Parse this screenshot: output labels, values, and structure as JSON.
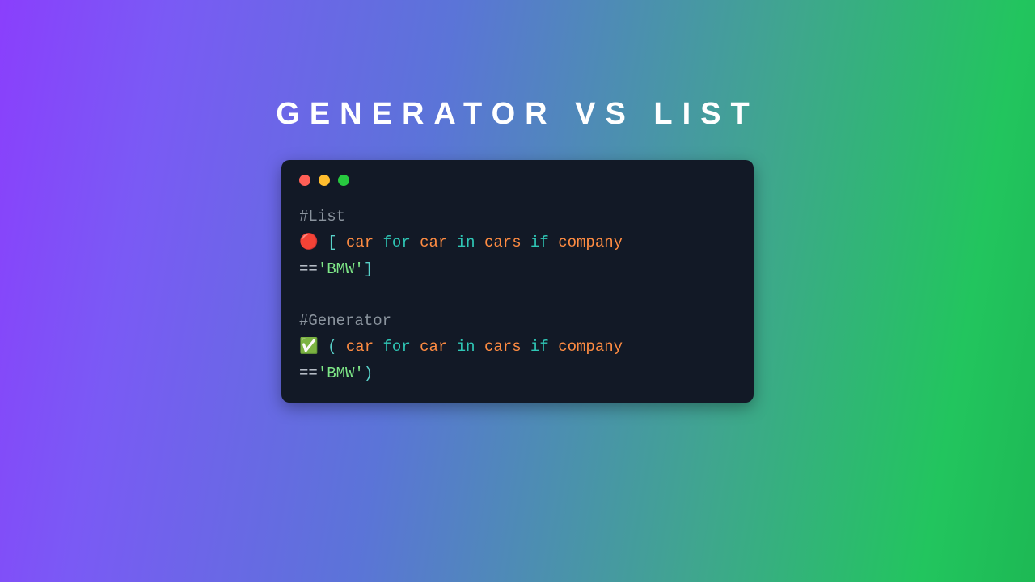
{
  "title": "GENERATOR VS LIST",
  "traffic": {
    "red": "#ff5f56",
    "yellow": "#ffbd2e",
    "green": "#27c93f"
  },
  "block1": {
    "comment": "#List",
    "emoji": "🔴",
    "open": "[",
    "close": "]",
    "var": "car",
    "for": "for",
    "in": "in",
    "collection": "cars",
    "if": "if",
    "cond_var": "company",
    "eq": "==",
    "value": "'BMW'"
  },
  "block2": {
    "comment": "#Generator",
    "emoji": "✅",
    "open": "(",
    "close": ")",
    "var": "car",
    "for": "for",
    "in": "in",
    "collection": "cars",
    "if": "if",
    "cond_var": "company",
    "eq": "==",
    "value": "'BMW'"
  }
}
